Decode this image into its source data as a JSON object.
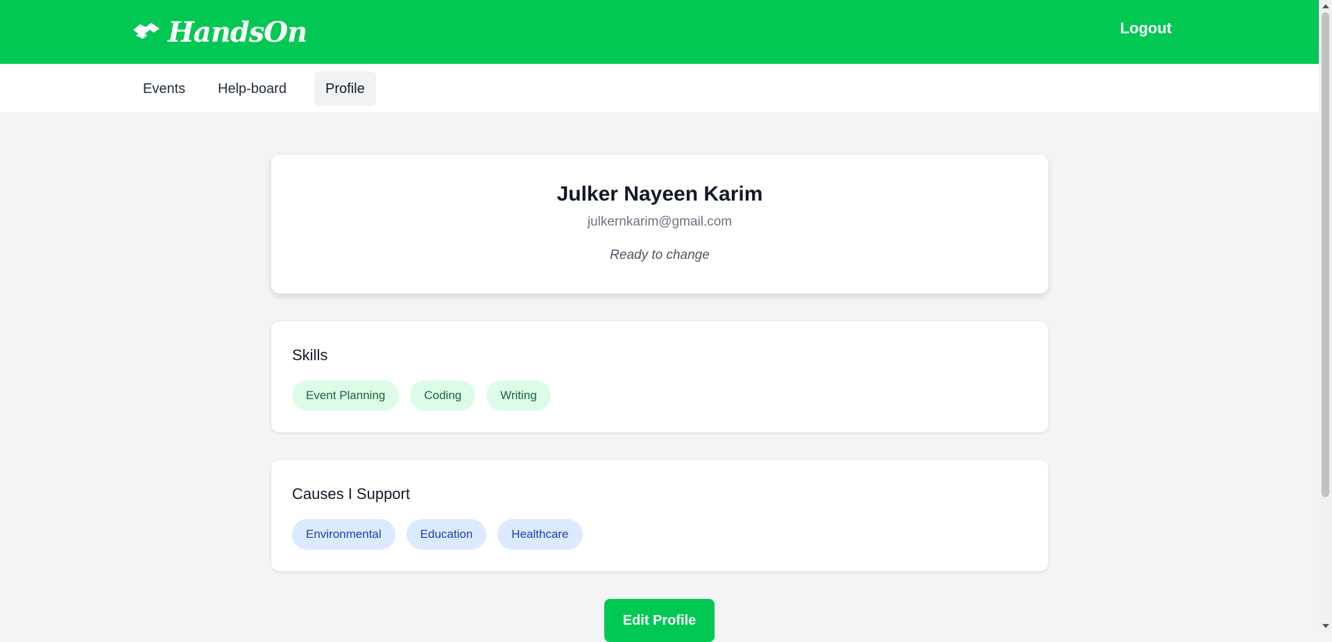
{
  "header": {
    "logo_text": "HandsOn",
    "logo_icon": "handshake-icon",
    "logout_label": "Logout",
    "brand_color": "#00c853"
  },
  "nav": {
    "items": [
      {
        "label": "Events",
        "active": false
      },
      {
        "label": "Help-board",
        "active": false
      },
      {
        "label": "Profile",
        "active": true
      }
    ]
  },
  "profile": {
    "name": "Julker Nayeen Karim",
    "email": "julkernkarim@gmail.com",
    "bio": "Ready to change"
  },
  "skills": {
    "title": "Skills",
    "items": [
      "Event Planning",
      "Coding",
      "Writing"
    ]
  },
  "causes": {
    "title": "Causes I Support",
    "items": [
      "Environmental",
      "Education",
      "Healthcare"
    ]
  },
  "actions": {
    "edit_label": "Edit Profile"
  }
}
